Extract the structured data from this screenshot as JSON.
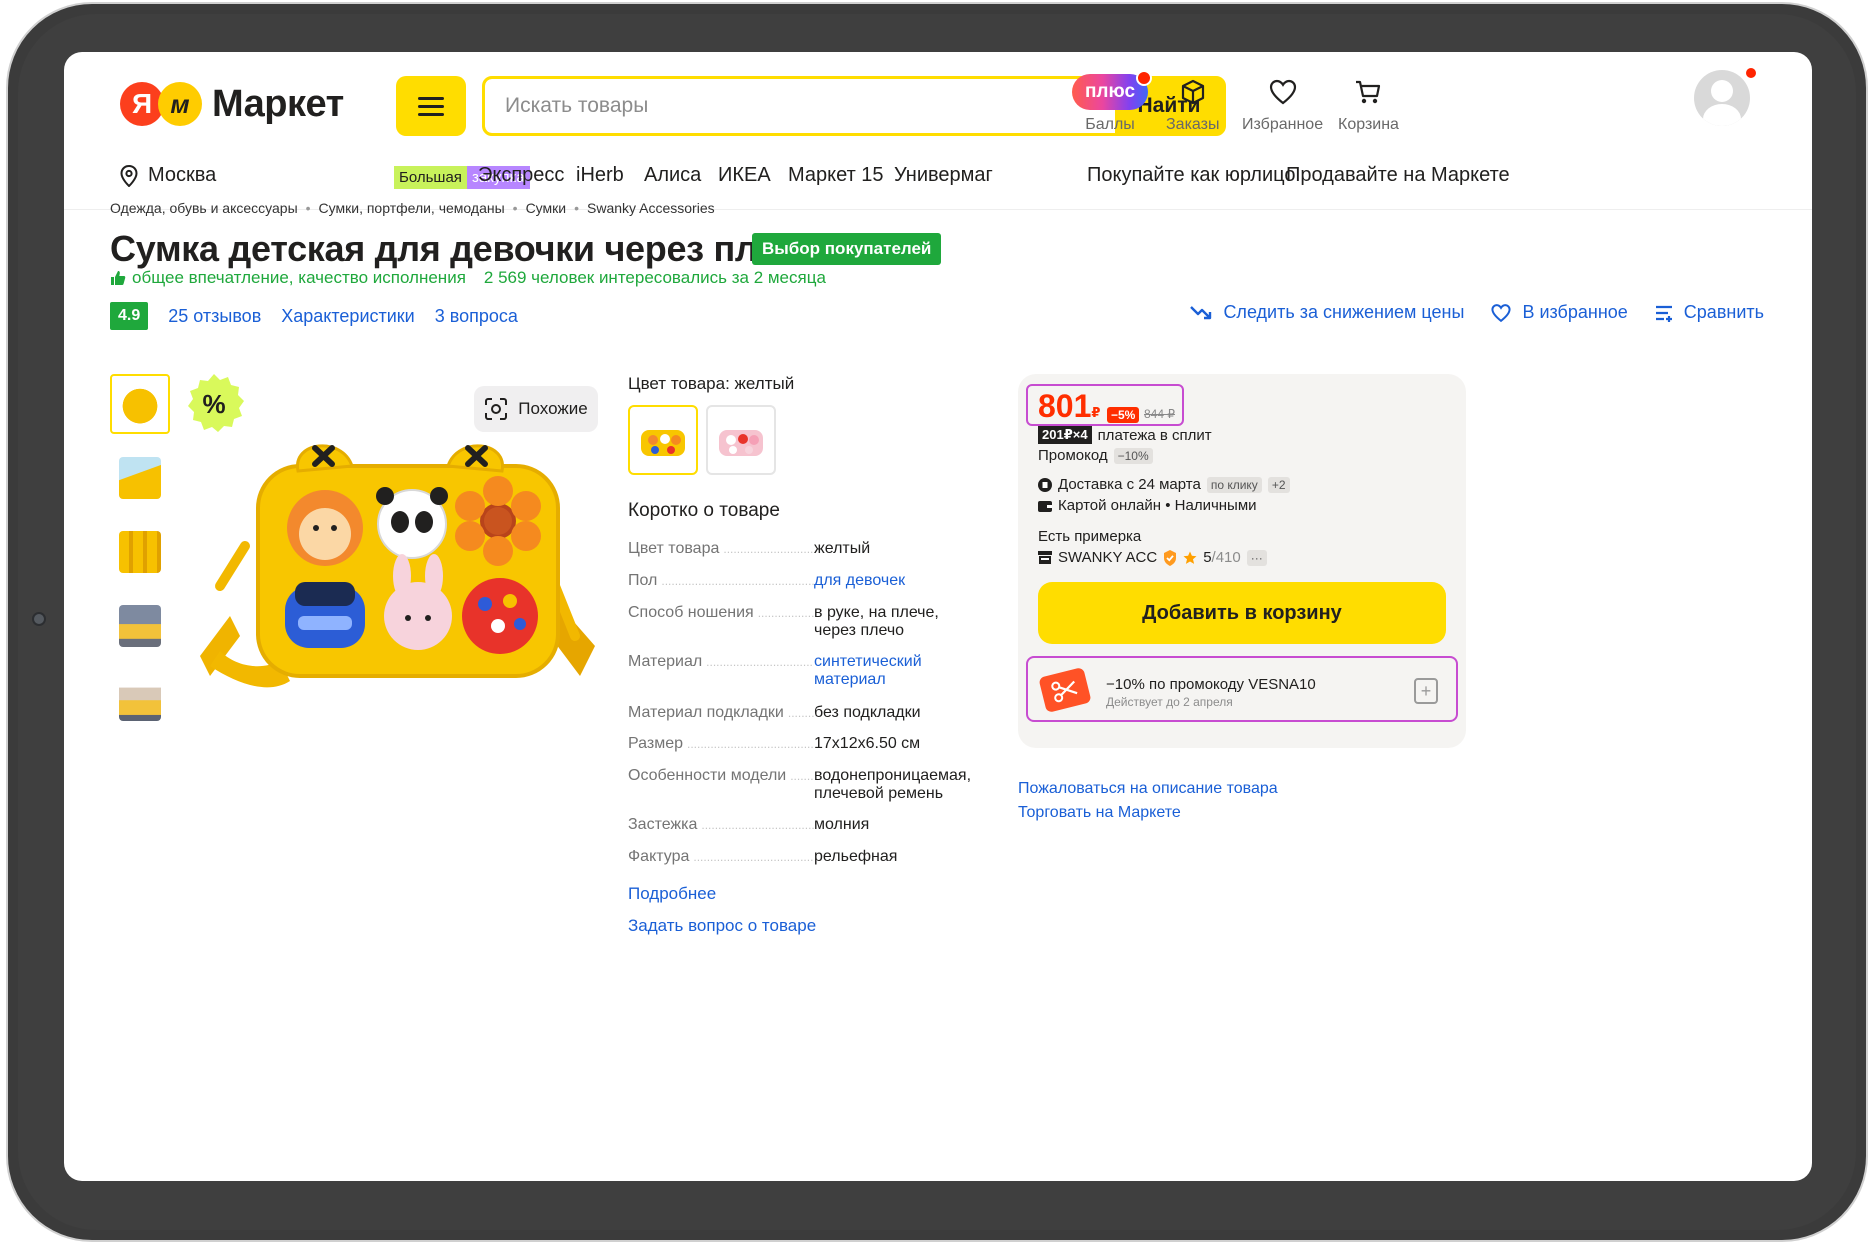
{
  "header": {
    "logo_ya": "Я",
    "logo_m": "м",
    "logo_text": "Маркет",
    "search_placeholder": "Искать товары",
    "search_button": "Найти",
    "plus_label": "плюс",
    "points_label": "Баллы",
    "orders_label": "Заказы",
    "favorites_label": "Избранное",
    "cart_label": "Корзина"
  },
  "subnav": {
    "city": "Москва",
    "bulk_a": "Большая",
    "bulk_b": "закупка",
    "items": [
      "Экспресс",
      "iHerb",
      "Алиса",
      "ИКЕА",
      "Маркет 15",
      "Универмаг"
    ],
    "business": "Покупайте как юрлицо",
    "sell": "Продавайте на Маркете"
  },
  "breadcrumbs": [
    "Одежда, обувь и аксессуары",
    "Сумки, портфели, чемоданы",
    "Сумки",
    "Swanky Accessories"
  ],
  "product": {
    "title": "Сумка детская для девочки через плечо",
    "choice_badge": "Выбор покупателей",
    "praise": "общее впечатление, качество исполнения",
    "interest": "2 569 человек интересовались за 2 месяца",
    "rating": "4.9",
    "reviews": "25 отзывов",
    "specs_link": "Характеристики",
    "questions": "3 вопроса",
    "track_price": "Следить за снижением цены",
    "to_favorites": "В избранное",
    "compare": "Сравнить",
    "similar": "Похожие",
    "discount_badge": "%"
  },
  "color": {
    "label": "Цвет товара: желтый"
  },
  "about": {
    "title": "Коротко о товаре",
    "specs": [
      {
        "k": "Цвет товара",
        "v": "желтый",
        "link": false
      },
      {
        "k": "Пол",
        "v": "для девочек",
        "link": true
      },
      {
        "k": "Способ ношения",
        "v": "в руке, на плече, через плечо",
        "link": false
      },
      {
        "k": "Материал",
        "v": "синтетический материал",
        "link": true
      },
      {
        "k": "Материал подкладки",
        "v": "без подкладки",
        "link": false
      },
      {
        "k": "Размер",
        "v": "17x12x6.50 см",
        "link": false
      },
      {
        "k": "Особенности модели",
        "v": "водонепроницаемая, плечевой ремень",
        "link": false
      },
      {
        "k": "Застежка",
        "v": "молния",
        "link": false
      },
      {
        "k": "Фактура",
        "v": "рельефная",
        "link": false
      }
    ],
    "more": "Подробнее",
    "ask": "Задать вопрос о товаре"
  },
  "buy": {
    "price": "801",
    "currency": "₽",
    "discount": "−5%",
    "old_price": "844 ₽",
    "split_chip": "201₽×4",
    "split_text": "платежа в сплит",
    "promo_label": "Промокод",
    "promo_chip": "−10%",
    "delivery": "Доставка с 24 марта",
    "delivery_chip": "по клику",
    "delivery_more": "+2",
    "payment": "Картой онлайн • Наличными",
    "fitting": "Есть примерка",
    "seller": "SWANKY ACC",
    "seller_rating": "5",
    "seller_reviews": "/410",
    "seller_more": "···",
    "add_to_cart": "Добавить в корзину",
    "promo_title": "−10% по промокоду VESNA10",
    "promo_sub": "Действует до 2 апреля",
    "complain": "Пожаловаться на описание товара",
    "trade": "Торговать на Маркете"
  },
  "colors": {
    "brand_yellow": "#ffdd00",
    "price_red": "#ff2e00",
    "link_blue": "#1a5fd6",
    "green": "#1fa83c",
    "highlight": "#c74cd1"
  }
}
